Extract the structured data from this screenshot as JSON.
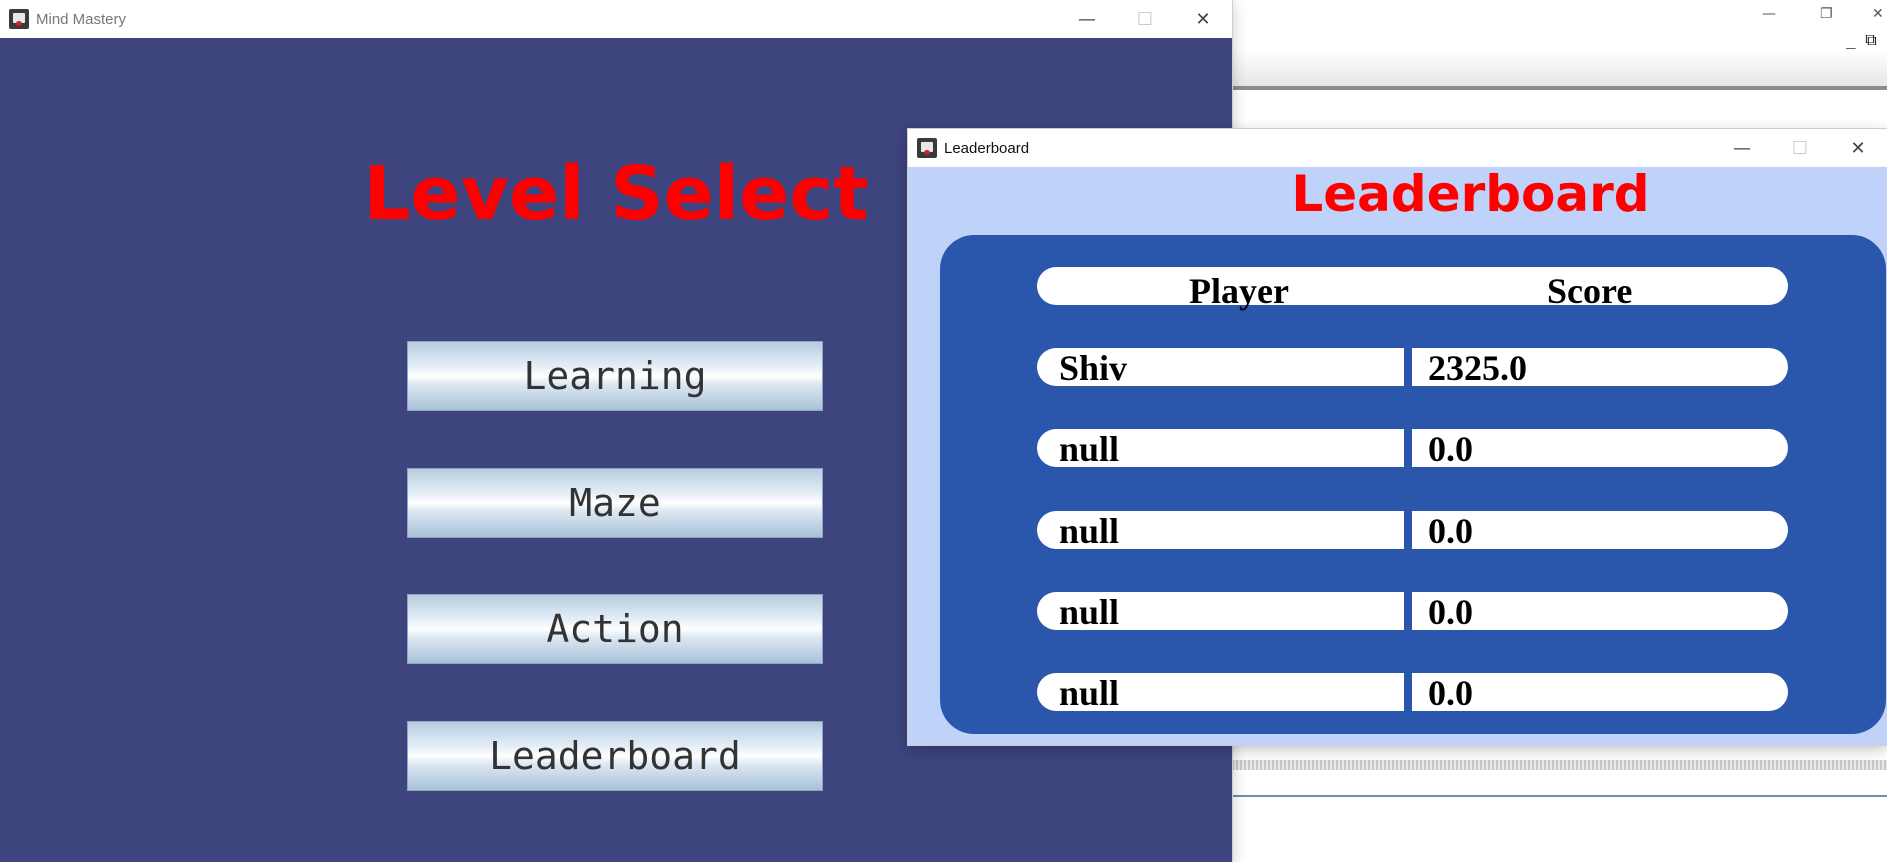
{
  "background_window": {
    "caption_minimize": "—",
    "caption_restore": "❐",
    "caption_close": "✕",
    "corner_glyphs": "_ ⧉"
  },
  "mind_window": {
    "title": "Mind Mastery",
    "caption": {
      "minimize": "—",
      "maximize": "☐",
      "close": "✕"
    },
    "heading": "Level Select",
    "buttons": [
      "Learning",
      "Maze",
      "Action",
      "Leaderboard"
    ],
    "colors": {
      "panel": "#3d447e",
      "heading": "#ff0000"
    }
  },
  "leaderboard_window": {
    "title": "Leaderboard",
    "caption": {
      "minimize": "—",
      "maximize": "☐",
      "close": "✕"
    },
    "heading": "Leaderboard",
    "columns": {
      "player": "Player",
      "score": "Score"
    },
    "rows": [
      {
        "player": "Shiv",
        "score": "2325.0"
      },
      {
        "player": "null",
        "score": "0.0"
      },
      {
        "player": "null",
        "score": "0.0"
      },
      {
        "player": "null",
        "score": "0.0"
      },
      {
        "player": "null",
        "score": "0.0"
      }
    ],
    "colors": {
      "panel": "#bfd3fa",
      "board": "#2a56ac",
      "heading": "#ff0000"
    }
  }
}
